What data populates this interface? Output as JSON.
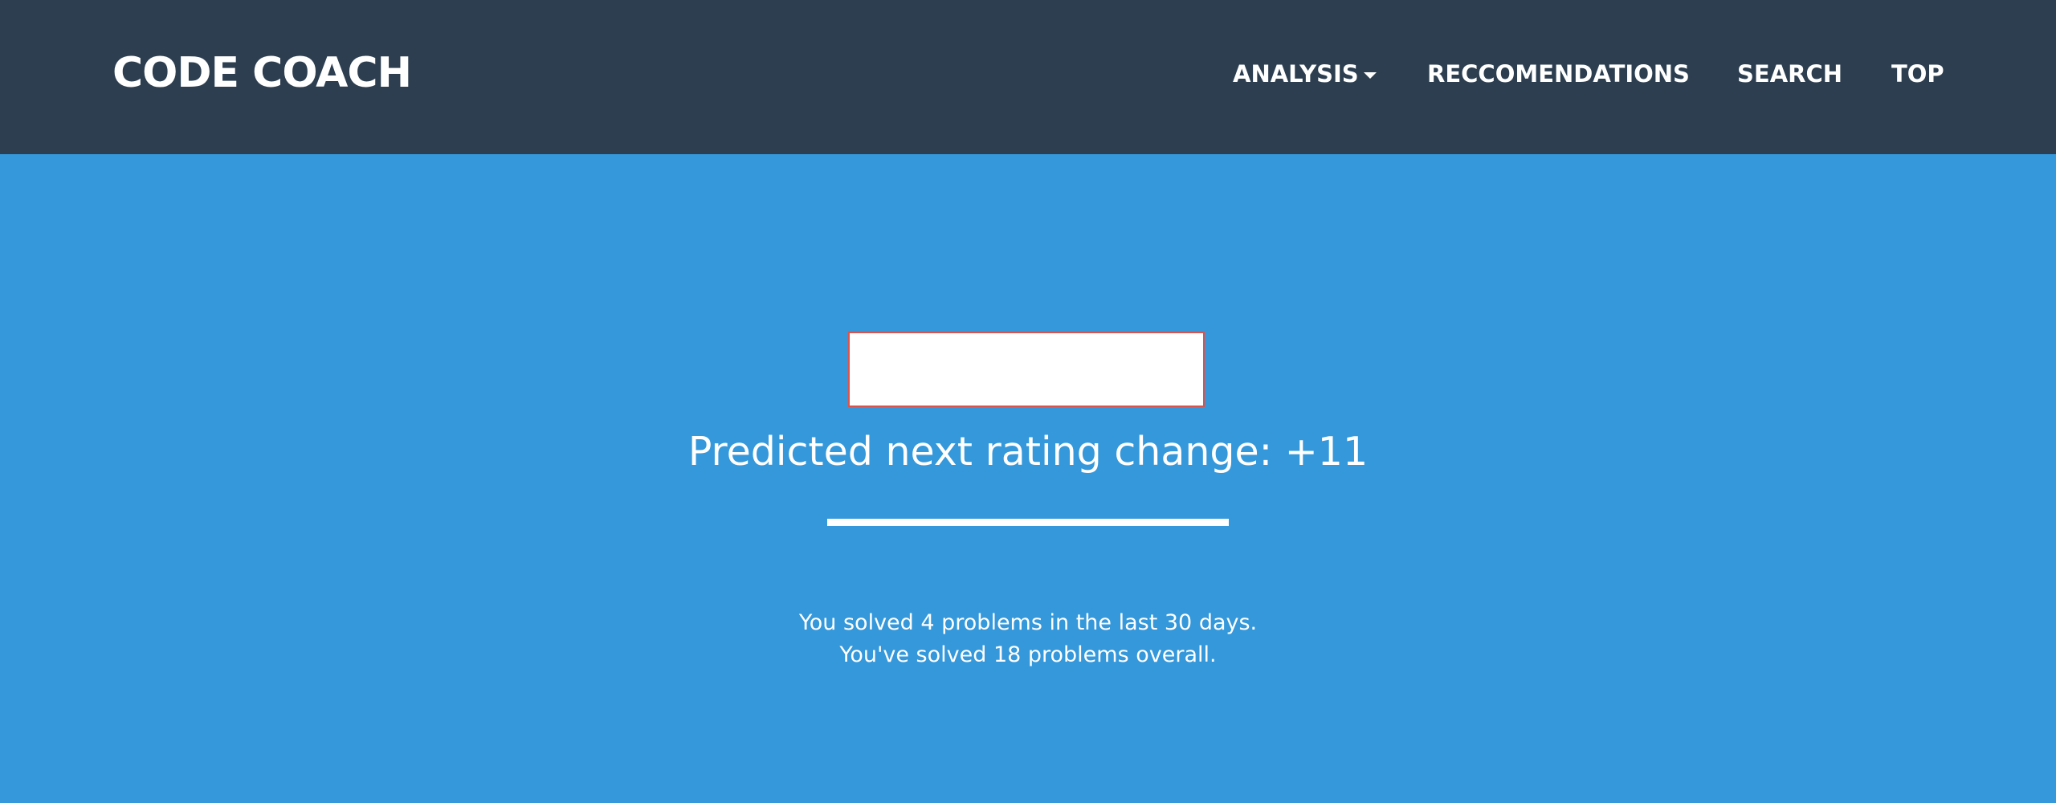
{
  "navbar": {
    "brand": "CODE COACH",
    "items": [
      {
        "label": "ANALYSIS",
        "has_dropdown": true
      },
      {
        "label": "RECCOMENDATIONS"
      },
      {
        "label": "SEARCH"
      },
      {
        "label": "TOP"
      }
    ]
  },
  "main": {
    "prediction_text": "Predicted next rating change: +11",
    "stats": [
      "You solved 4 problems in the last 30 days.",
      "You've solved 18 problems overall."
    ]
  },
  "colors": {
    "navbar_background": "#2c3e50",
    "page_background": "#3498db",
    "text": "#ffffff",
    "box_border": "#d9534f"
  },
  "icons": {
    "dropdown": "caret-down-icon"
  }
}
